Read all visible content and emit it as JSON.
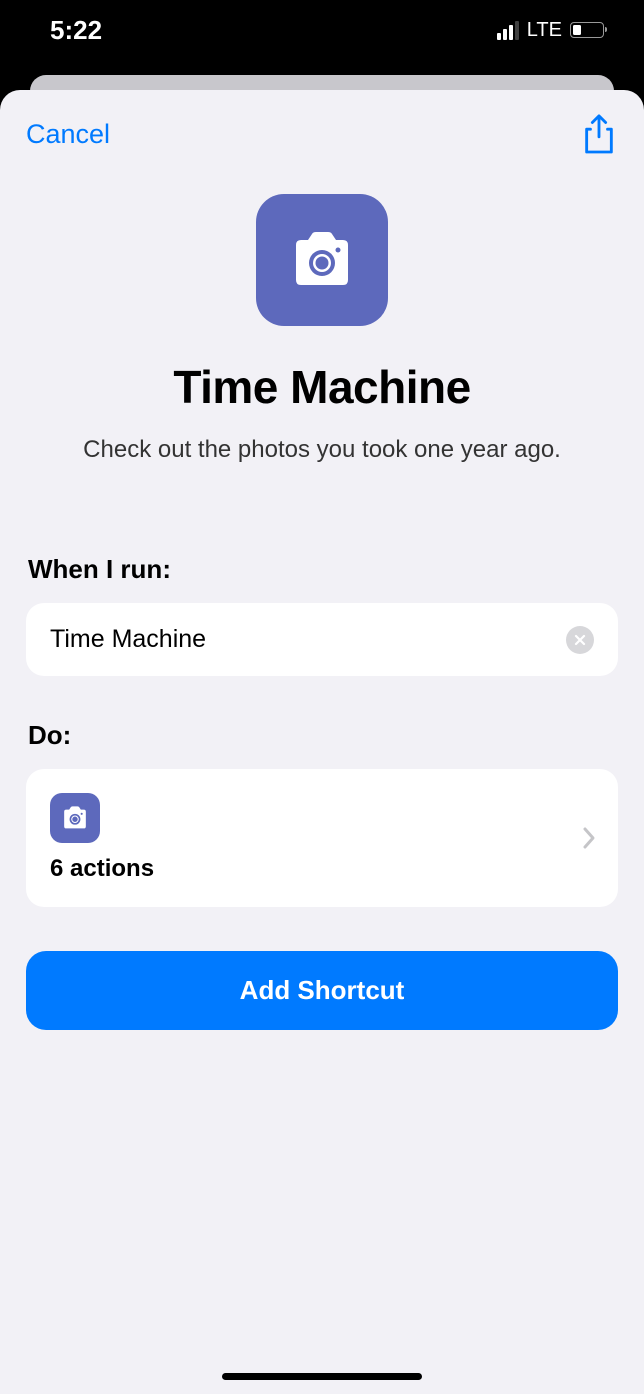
{
  "statusBar": {
    "time": "5:22",
    "network": "LTE"
  },
  "header": {
    "cancel": "Cancel"
  },
  "shortcut": {
    "title": "Time Machine",
    "subtitle": "Check out the photos you took one year ago."
  },
  "sections": {
    "whenLabel": "When I run:",
    "whenValue": "Time Machine",
    "doLabel": "Do:",
    "actionsCount": "6 actions"
  },
  "addButton": "Add Shortcut"
}
